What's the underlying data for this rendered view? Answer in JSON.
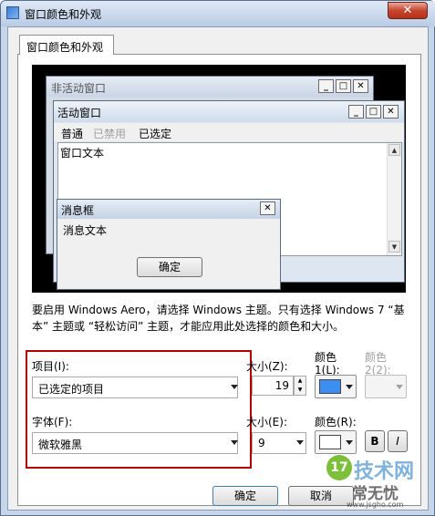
{
  "window": {
    "title": "窗口颜色和外观",
    "close_label": "✕"
  },
  "tab": {
    "label": "窗口颜色和外观"
  },
  "preview": {
    "inactive_title": "非活动窗口",
    "active_title": "活动窗口",
    "menu": {
      "normal": "普通",
      "disabled": "已禁用",
      "selected": "已选定"
    },
    "window_text": "窗口文本",
    "msgbox_title": "消息框",
    "msgbox_text": "消息文本",
    "msgbox_ok": "确定",
    "cap_min": "_",
    "cap_max": "□",
    "cap_close": "✕"
  },
  "hint": "要启用 Windows Aero，请选择 Windows 主题。只有选择 Windows 7 “基本” 主题或 “轻松访问” 主题，才能应用此处选择的颜色和大小。",
  "item": {
    "label": "项目(I):",
    "value": "已选定的项目",
    "size_label": "大小(Z):",
    "size_value": "19",
    "color1_label": "颜色 1(L):",
    "color2_label": "颜色 2(2):",
    "color1": "#3c8ff0"
  },
  "font": {
    "label": "字体(F):",
    "value": "微软雅黑",
    "size_label": "大小(E):",
    "size_value": "9",
    "color_label": "颜色(R):",
    "bold": "B",
    "italic": "I"
  },
  "buttons": {
    "ok": "确定",
    "cancel": "取消"
  },
  "watermark": {
    "text1": "技术网",
    "text2": "常无忧",
    "site": "www.jsgho.com"
  },
  "colors": {
    "highlight_border": "#b40000",
    "selected_menu_bg": "#3c8ff0"
  }
}
